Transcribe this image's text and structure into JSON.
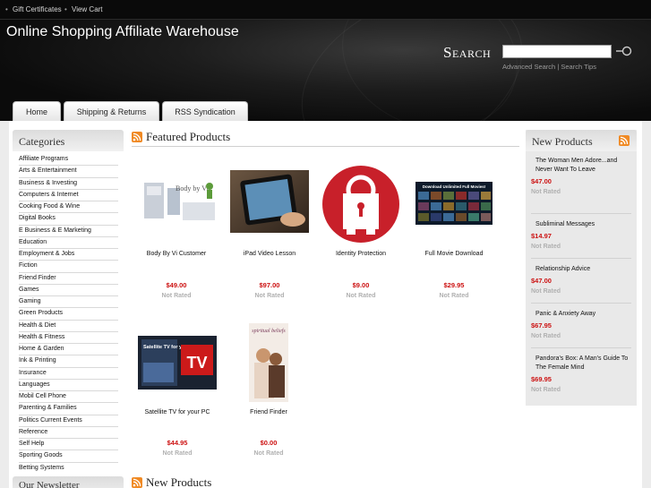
{
  "topbar": {
    "links": [
      "Gift Certificates",
      "View Cart"
    ]
  },
  "header": {
    "site_title": "Online Shopping Affiliate Warehouse",
    "search_label": "Search",
    "search_placeholder": "",
    "advanced_search": "Advanced Search",
    "search_tips": "Search Tips",
    "separator": "|"
  },
  "tabs": [
    "Home",
    "Shipping & Returns",
    "RSS Syndication"
  ],
  "categories": {
    "title": "Categories",
    "items": [
      "Affiliate Programs",
      "Arts & Entertainment",
      "Business & Investing",
      "Computers & Internet",
      "Cooking Food & Wine",
      "Digital Books",
      "E Business & E Marketing",
      "Education",
      "Employment & Jobs",
      "Fiction",
      "Friend Finder",
      "Games",
      "Gaming",
      "Green Products",
      "Health & Diet",
      "Health & Fitness",
      "Home & Garden",
      "Ink & Printing",
      "Insurance",
      "Languages",
      "Mobil Cell Phone",
      "Parenting & Families",
      "Politics Current Events",
      "Reference",
      "Self Help",
      "Sporting Goods",
      "Betting Systems"
    ]
  },
  "newsletter": {
    "title": "Our Newsletter"
  },
  "featured": {
    "title": "Featured Products",
    "products": [
      {
        "name": "Body By Vi Customer",
        "price": "$49.00",
        "rating": "Not Rated",
        "thumb_text": "Body by Vi"
      },
      {
        "name": "iPad Video Lesson",
        "price": "$97.00",
        "rating": "Not Rated"
      },
      {
        "name": "Identity Protection",
        "price": "$9.00",
        "rating": "Not Rated"
      },
      {
        "name": "Full Movie Download",
        "price": "$29.95",
        "rating": "Not Rated",
        "thumb_text": "Download Unlimited Full Movies!"
      },
      {
        "name": "Satellite TV for your PC",
        "price": "$44.95",
        "rating": "Not Rated",
        "thumb_text": "Satellite TV for your PC!",
        "thumb_text2": "TV"
      },
      {
        "name": "Friend Finder",
        "price": "$0.00",
        "rating": "Not Rated",
        "thumb_text": "spiritual beliefs"
      }
    ]
  },
  "new_products_section": {
    "title": "New Products"
  },
  "new_products": {
    "title": "New Products",
    "items": [
      {
        "name": "The Woman Men Adore...and Never Want To Leave",
        "price": "$47.00",
        "rating": "Not Rated"
      },
      {
        "name": "Subliminal Messages",
        "price": "$14.97",
        "rating": "Not Rated"
      },
      {
        "name": "Relationship Advice",
        "price": "$47.00",
        "rating": "Not Rated"
      },
      {
        "name": "Panic & Anxiety Away",
        "price": "$67.95",
        "rating": "Not Rated"
      },
      {
        "name": "Pandora's Box: A Man's Guide To The Female Mind",
        "price": "$69.95",
        "rating": "Not Rated"
      }
    ]
  },
  "colors": {
    "price": "#cc1111",
    "rss": "#f08a24",
    "header_bg": "#0b0b0b"
  }
}
